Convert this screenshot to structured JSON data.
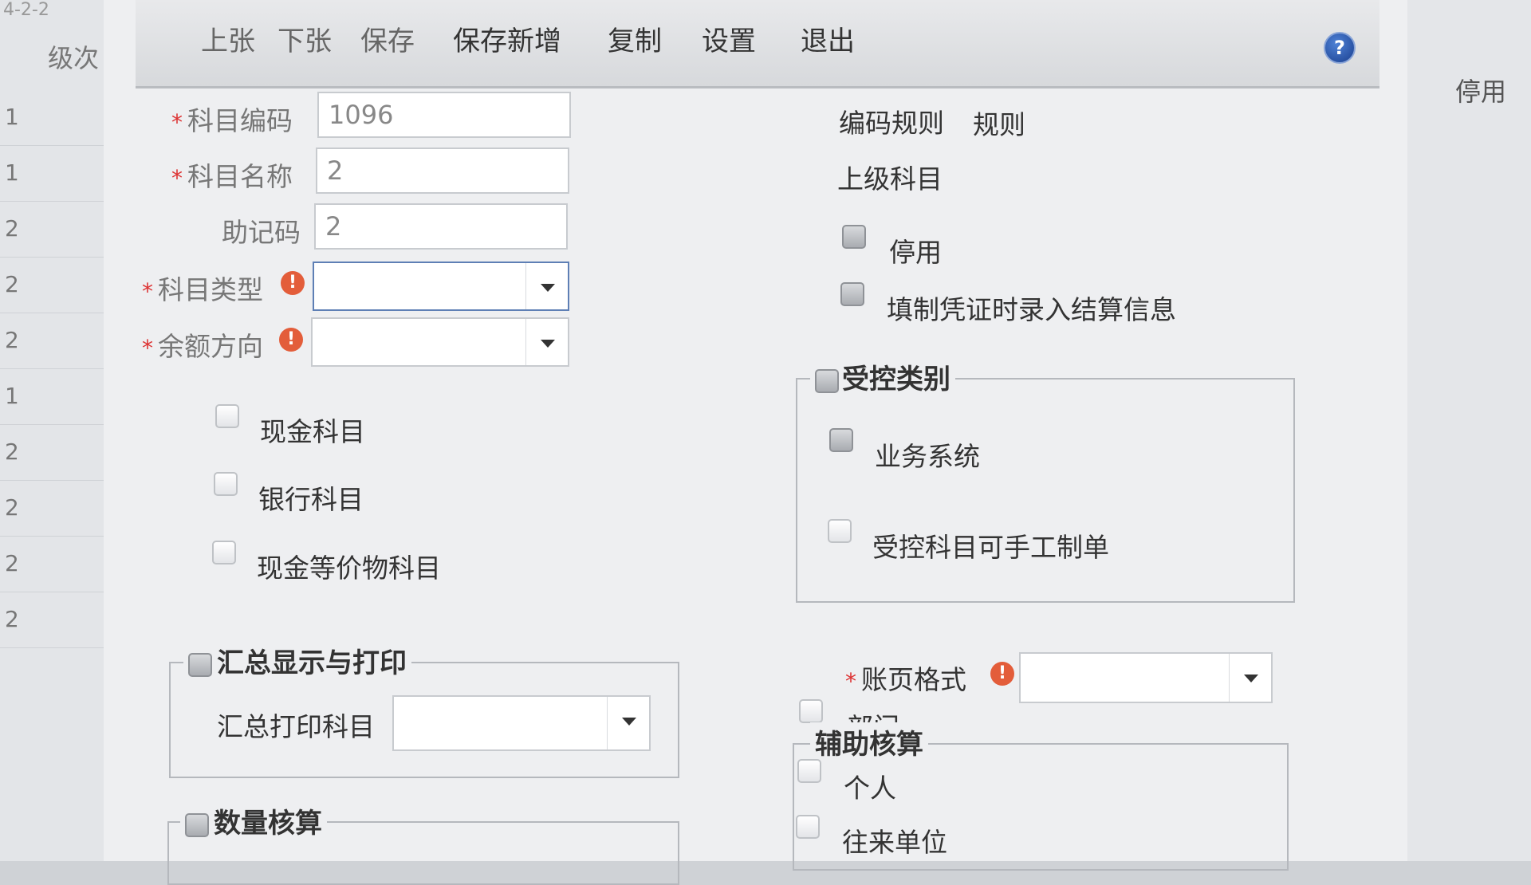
{
  "background": {
    "top_text": "4-2-2",
    "list_header": "级次",
    "rows": [
      "1",
      "1",
      "2",
      "2",
      "2",
      "1",
      "2",
      "2",
      "2",
      "2"
    ],
    "right_column": "停用"
  },
  "toolbar": {
    "prev": "上张",
    "next": "下张",
    "save": "保存",
    "save_new": "保存新增",
    "copy": "复制",
    "settings": "设置",
    "exit": "退出",
    "help_glyph": "?"
  },
  "form": {
    "required_mark": "*",
    "code_label": "科目编码",
    "code_value": "1096",
    "name_label": "科目名称",
    "name_value": "2",
    "mnemonic_label": "助记码",
    "mnemonic_value": "2",
    "type_label": "科目类型",
    "balance_label": "余额方向",
    "cash": "现金科目",
    "bank": "银行科目",
    "cash_equiv": "现金等价物科目",
    "summary_group": "汇总显示与打印",
    "summary_print_label": "汇总打印科目",
    "quantity_group": "数量核算"
  },
  "right": {
    "code_rule_label": "编码规则",
    "code_rule_value": "规则",
    "parent_label": "上级科目",
    "disable": "停用",
    "settle_info": "填制凭证时录入结算信息",
    "controlled_group": "受控类别",
    "business_system": "业务系统",
    "manual_voucher": "受控科目可手工制单",
    "ledger_format_label": "账页格式",
    "aux_group": "辅助核算",
    "dept": "部门",
    "person": "个人",
    "partner": "往来单位"
  },
  "warn_glyph": "!"
}
